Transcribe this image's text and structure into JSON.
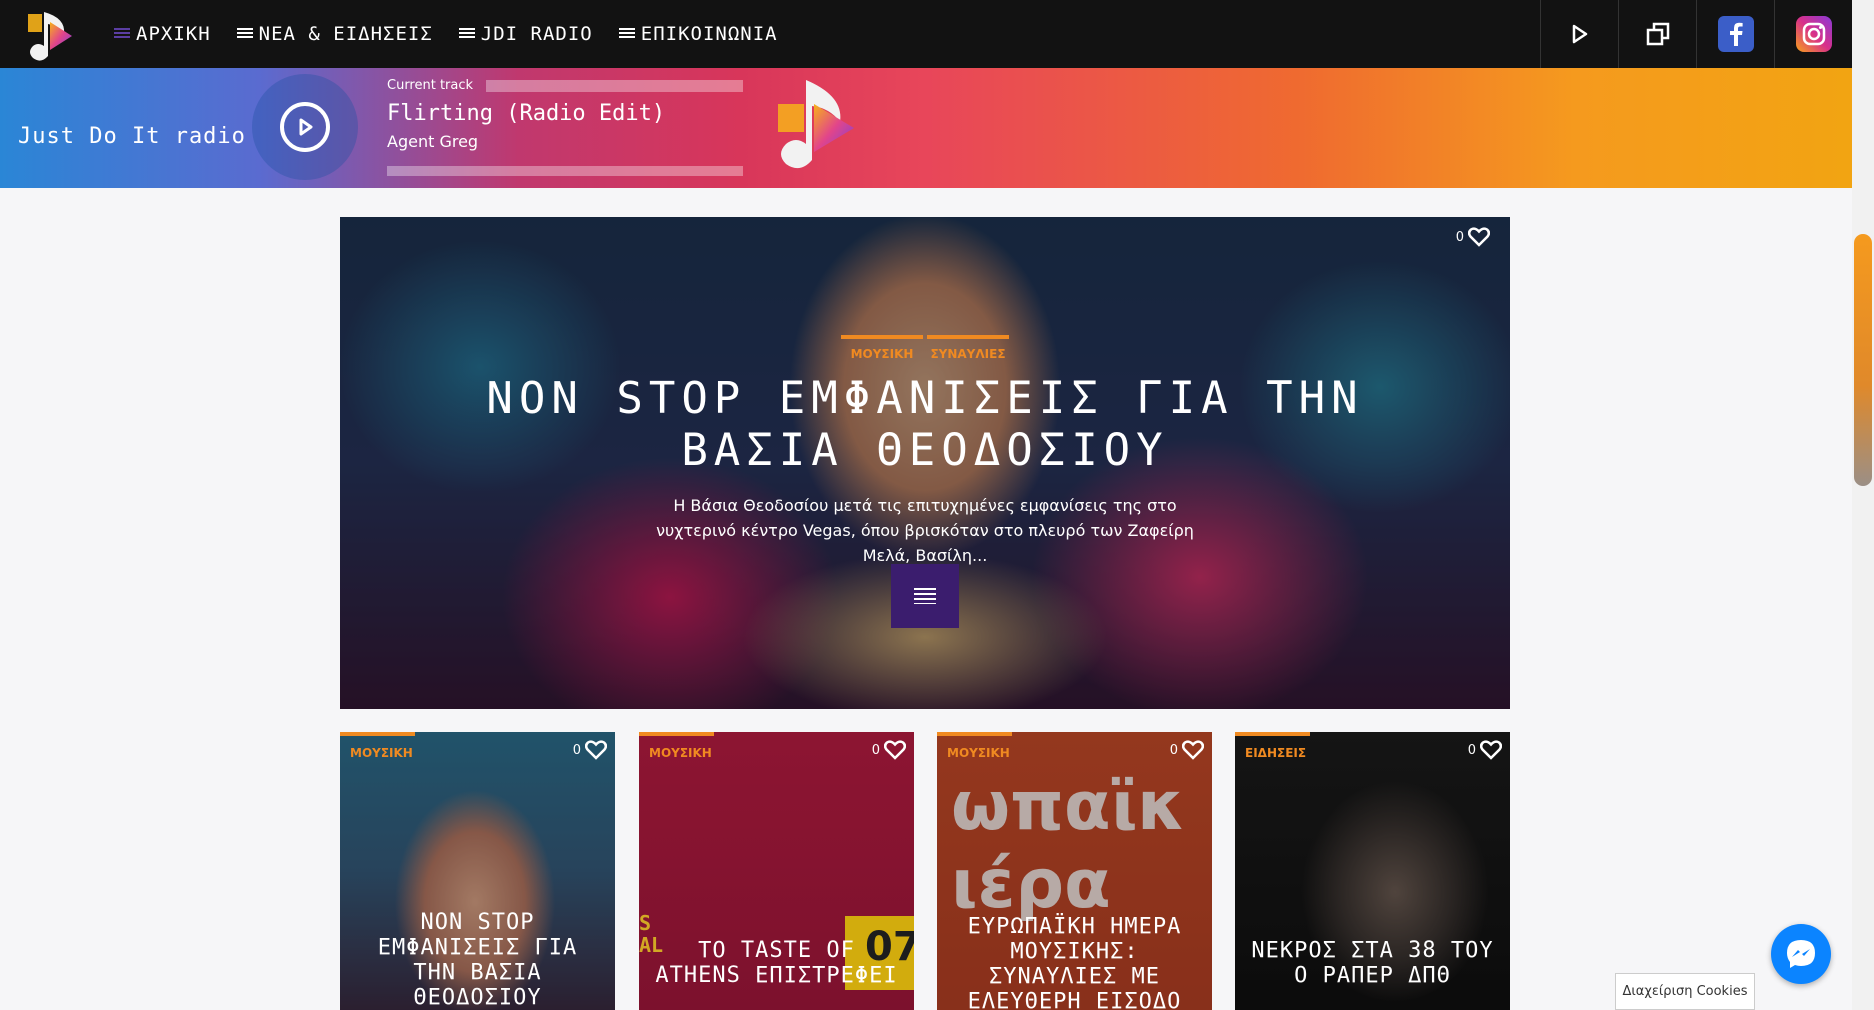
{
  "nav": {
    "items": [
      {
        "label": "ΑΡΧΙΚΗ"
      },
      {
        "label": "ΝΕΑ & ΕΙΔΗΣΕΙΣ"
      },
      {
        "label": "JDI RADIO"
      },
      {
        "label": "ΕΠΙΚΟΙΝΩΝΙΑ"
      }
    ]
  },
  "top_actions": [
    "play-icon",
    "popup-window-icon",
    "facebook-icon",
    "instagram-icon"
  ],
  "player": {
    "station": "Just Do It radio",
    "current_label": "Current track",
    "track_title": "Flirting (Radio Edit)",
    "artist": "Agent Greg"
  },
  "hero": {
    "likes": "0",
    "categories": [
      "ΜΟΥΣΙΚΗ",
      "ΣΥΝΑΥΛΙΕΣ"
    ],
    "title": "NON STOP ΕΜΦΑΝΙΣΕΙΣ ΓΙΑ ΤΗΝ ΒΑΣΙΑ ΘΕΟΔΟΣΙΟΥ",
    "excerpt": "Η Βάσια Θεοδοσίου μετά τις επιτυχημένες εμφανίσεις της στο νυχτερινό κέντρο Vegas, όπου βρισκόταν στο πλευρό των Ζαφείρη Μελά, Βασίλη..."
  },
  "cards": [
    {
      "category": "ΜΟΥΣΙΚΗ",
      "likes": "0",
      "title": "NON STOP ΕΜΦΑΝΙΣΕΙΣ ΓΙΑ ΤΗΝ ΒΑΣΙΑ ΘΕΟΔΟΣΙΟΥ"
    },
    {
      "category": "ΜΟΥΣΙΚΗ",
      "likes": "0",
      "title": "ΤΟ TASTE OF ATHENS ΕΠΙΣΤΡΕΦΕΙ"
    },
    {
      "category": "ΜΟΥΣΙΚΗ",
      "likes": "0",
      "title": "ΕΥΡΩΠΑΪΚΗ ΗΜΕΡΑ ΜΟΥΣΙΚΗΣ: ΣΥΝΑΥΛΙΕΣ ΜΕ ΕΛΕΥΘΕΡΗ ΕΙΣΟΔΟ ΣΕ ΟΛΗ ΤΗ ΧΩΡΑ"
    },
    {
      "category": "ΕΙΔΗΣΕΙΣ",
      "likes": "0",
      "title": "ΝΕΚΡΟΣ ΣΤΑ 38 ΤΟΥ Ο ΡΑΠΕΡ ΔΠΘ"
    }
  ],
  "card_image_text": {
    "c2_left": "S\nAL",
    "c2_right": "07",
    "c3": "ωπαϊκ\nιέρα"
  },
  "cookies_label": "Διαχείριση Cookies",
  "colors": {
    "accent": "#f08a21",
    "button": "#3b1d6e",
    "messenger": "#0b84ff"
  }
}
